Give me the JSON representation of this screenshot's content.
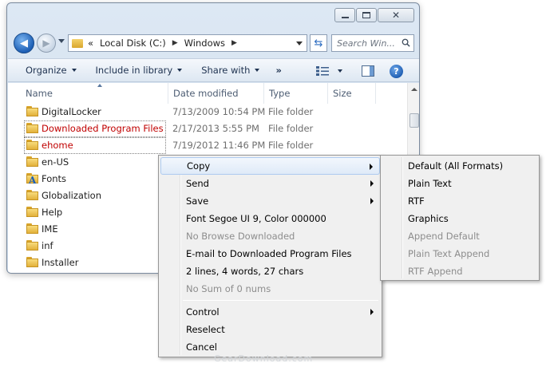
{
  "window": {
    "address_segments": [
      "«",
      "Local Disk (C:)",
      "Windows"
    ],
    "search_placeholder": "Search Win..."
  },
  "toolbar": {
    "organize": "Organize",
    "include_in_library": "Include in library",
    "share_with": "Share with",
    "more": "»"
  },
  "columns": {
    "name": "Name",
    "date_modified": "Date modified",
    "type": "Type",
    "size": "Size"
  },
  "files": [
    {
      "name": "DigitalLocker",
      "date": "7/13/2009 10:54 PM",
      "type": "File folder"
    },
    {
      "name": "Downloaded Program Files",
      "date": "2/17/2013 5:55 PM",
      "type": "File folder"
    },
    {
      "name": "ehome",
      "date": "7/19/2012 11:46 PM",
      "type": "File folder"
    },
    {
      "name": "en-US"
    },
    {
      "name": "Fonts"
    },
    {
      "name": "Globalization"
    },
    {
      "name": "Help"
    },
    {
      "name": "IME"
    },
    {
      "name": "inf"
    },
    {
      "name": "Installer"
    }
  ],
  "context_menu": {
    "items": [
      {
        "label": "Copy"
      },
      {
        "label": "Send"
      },
      {
        "label": "Save"
      },
      {
        "label": "Font Segoe UI 9, Color 000000"
      },
      {
        "label": "No Browse Downloaded"
      },
      {
        "label": "E-mail to Downloaded Program Files"
      },
      {
        "label": "2 lines, 4 words, 27 chars"
      },
      {
        "label": "No Sum of 0 nums"
      },
      {
        "label": "Control"
      },
      {
        "label": "Reselect"
      },
      {
        "label": "Cancel"
      }
    ]
  },
  "copy_submenu": {
    "items": [
      {
        "label": "Default (All Formats)"
      },
      {
        "label": "Plain Text"
      },
      {
        "label": "RTF"
      },
      {
        "label": "Graphics"
      },
      {
        "label": "Append Default"
      },
      {
        "label": "Plain Text Append"
      },
      {
        "label": "RTF Append"
      }
    ]
  },
  "watermark": "GearDownload.com"
}
